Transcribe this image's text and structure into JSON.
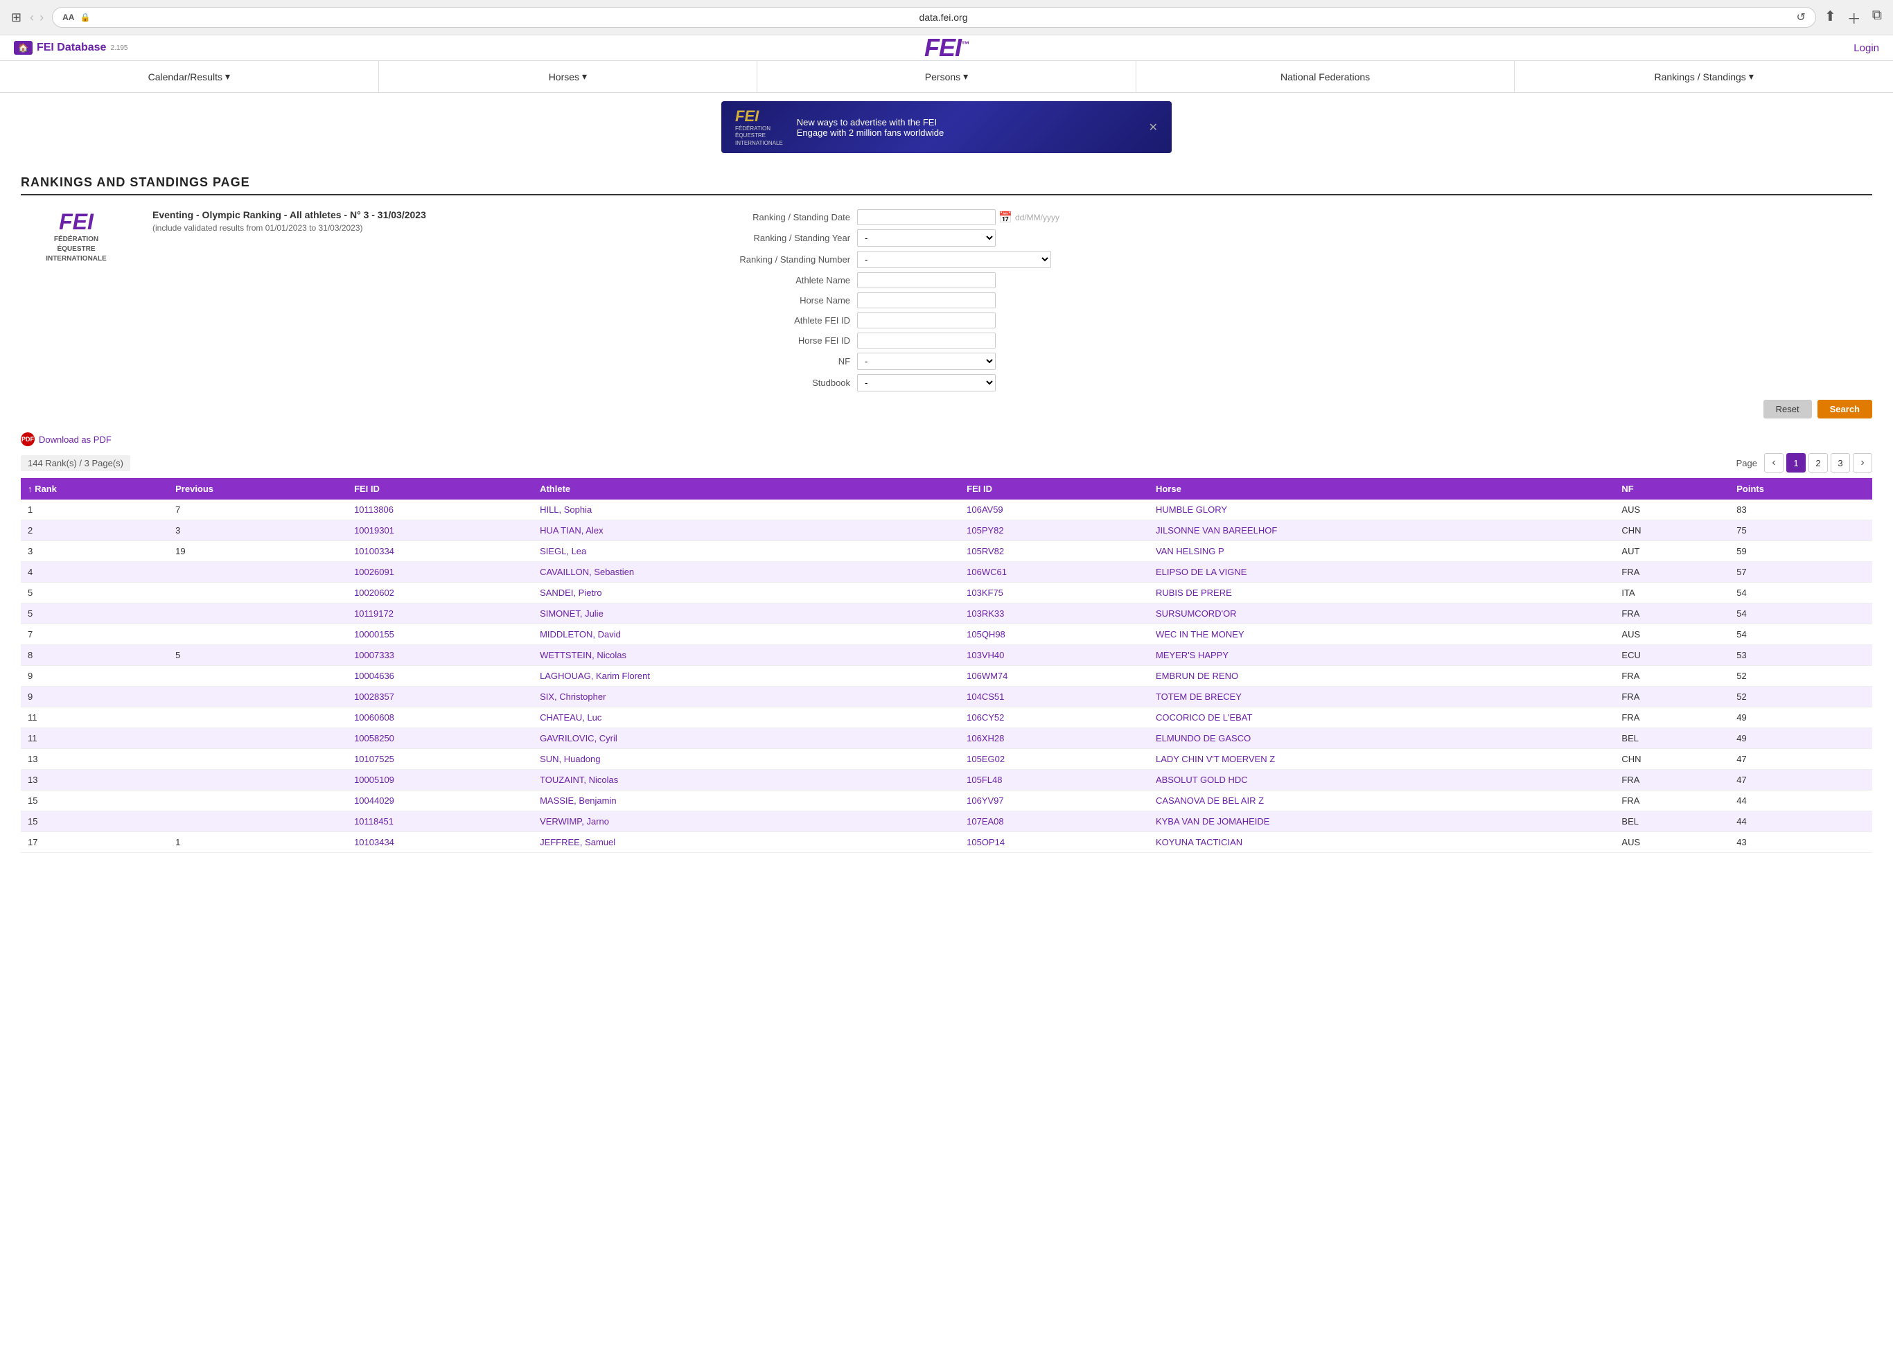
{
  "browser": {
    "aa_label": "AA",
    "url": "data.fei.org",
    "lock_icon": "🔒",
    "reload_icon": "↺"
  },
  "site": {
    "db_label": "FEI Database",
    "version": "2.195",
    "logo_text": "FEI",
    "logo_tm": "™",
    "login_label": "Login"
  },
  "nav": {
    "items": [
      {
        "label": "Calendar/Results",
        "has_dropdown": true
      },
      {
        "label": "Horses",
        "has_dropdown": true
      },
      {
        "label": "Persons",
        "has_dropdown": true
      },
      {
        "label": "National Federations",
        "has_dropdown": false
      },
      {
        "label": "Rankings / Standings",
        "has_dropdown": true
      }
    ]
  },
  "banner": {
    "logo": "FEI",
    "org_name": "FÉDÉRATION\nÉQUESTRE\nINTERNATIONALE",
    "headline": "New ways to advertise with the FEI",
    "subline": "Engage with 2 million fans worldwide"
  },
  "page_title": "RANKINGS AND STANDINGS PAGE",
  "ranking_info": {
    "title": "Eventing - Olympic Ranking - All athletes - N° 3 - 31/03/2023",
    "subtitle": "(include validated results from 01/01/2023 to 31/03/2023)"
  },
  "filter": {
    "ranking_date_label": "Ranking / Standing Date",
    "ranking_date_placeholder": "dd/MM/yyyy",
    "ranking_year_label": "Ranking / Standing Year",
    "ranking_number_label": "Ranking / Standing Number",
    "athlete_name_label": "Athlete Name",
    "horse_name_label": "Horse Name",
    "athlete_fei_id_label": "Athlete FEI ID",
    "horse_fei_id_label": "Horse FEI ID",
    "nf_label": "NF",
    "studbook_label": "Studbook",
    "reset_label": "Reset",
    "search_label": "Search"
  },
  "logo": {
    "text": "FEI",
    "org_line1": "FÉDÉRATION",
    "org_line2": "ÉQUESTRE",
    "org_line3": "INTERNATIONALE"
  },
  "download": {
    "label": "Download as PDF"
  },
  "pagination": {
    "record_count": "144 Rank(s) / 3 Page(s)",
    "page_label": "Page",
    "current_page": 1,
    "pages": [
      1,
      2,
      3
    ]
  },
  "table": {
    "columns": [
      "Rank",
      "Previous",
      "FEI ID",
      "Athlete",
      "FEI ID",
      "Horse",
      "NF",
      "Points"
    ],
    "rows": [
      {
        "rank": "1",
        "previous": "7",
        "fei_id_athlete": "10113806",
        "athlete": "HILL, Sophia",
        "fei_id_horse": "106AV59",
        "horse": "HUMBLE GLORY",
        "nf": "AUS",
        "points": "83"
      },
      {
        "rank": "2",
        "previous": "3",
        "fei_id_athlete": "10019301",
        "athlete": "HUA TIAN, Alex",
        "fei_id_horse": "105PY82",
        "horse": "JILSONNE VAN BAREELHOF",
        "nf": "CHN",
        "points": "75"
      },
      {
        "rank": "3",
        "previous": "19",
        "fei_id_athlete": "10100334",
        "athlete": "SIEGL, Lea",
        "fei_id_horse": "105RV82",
        "horse": "VAN HELSING P",
        "nf": "AUT",
        "points": "59"
      },
      {
        "rank": "4",
        "previous": "",
        "fei_id_athlete": "10026091",
        "athlete": "CAVAILLON, Sebastien",
        "fei_id_horse": "106WC61",
        "horse": "ELIPSO DE LA VIGNE",
        "nf": "FRA",
        "points": "57"
      },
      {
        "rank": "5",
        "previous": "",
        "fei_id_athlete": "10020602",
        "athlete": "SANDEI, Pietro",
        "fei_id_horse": "103KF75",
        "horse": "RUBIS DE PRERE",
        "nf": "ITA",
        "points": "54"
      },
      {
        "rank": "5",
        "previous": "",
        "fei_id_athlete": "10119172",
        "athlete": "SIMONET, Julie",
        "fei_id_horse": "103RK33",
        "horse": "SURSUMCORD'OR",
        "nf": "FRA",
        "points": "54"
      },
      {
        "rank": "7",
        "previous": "",
        "fei_id_athlete": "10000155",
        "athlete": "MIDDLETON, David",
        "fei_id_horse": "105QH98",
        "horse": "WEC IN THE MONEY",
        "nf": "AUS",
        "points": "54"
      },
      {
        "rank": "8",
        "previous": "5",
        "fei_id_athlete": "10007333",
        "athlete": "WETTSTEIN, Nicolas",
        "fei_id_horse": "103VH40",
        "horse": "MEYER'S HAPPY",
        "nf": "ECU",
        "points": "53"
      },
      {
        "rank": "9",
        "previous": "",
        "fei_id_athlete": "10004636",
        "athlete": "LAGHOUAG, Karim Florent",
        "fei_id_horse": "106WM74",
        "horse": "EMBRUN DE RENO",
        "nf": "FRA",
        "points": "52"
      },
      {
        "rank": "9",
        "previous": "",
        "fei_id_athlete": "10028357",
        "athlete": "SIX, Christopher",
        "fei_id_horse": "104CS51",
        "horse": "TOTEM DE BRECEY",
        "nf": "FRA",
        "points": "52"
      },
      {
        "rank": "11",
        "previous": "",
        "fei_id_athlete": "10060608",
        "athlete": "CHATEAU, Luc",
        "fei_id_horse": "106CY52",
        "horse": "COCORICO DE L'EBAT",
        "nf": "FRA",
        "points": "49"
      },
      {
        "rank": "11",
        "previous": "",
        "fei_id_athlete": "10058250",
        "athlete": "GAVRILOVIC, Cyril",
        "fei_id_horse": "106XH28",
        "horse": "ELMUNDO DE GASCO",
        "nf": "BEL",
        "points": "49"
      },
      {
        "rank": "13",
        "previous": "",
        "fei_id_athlete": "10107525",
        "athlete": "SUN, Huadong",
        "fei_id_horse": "105EG02",
        "horse": "LADY CHIN V'T MOERVEN Z",
        "nf": "CHN",
        "points": "47"
      },
      {
        "rank": "13",
        "previous": "",
        "fei_id_athlete": "10005109",
        "athlete": "TOUZAINT, Nicolas",
        "fei_id_horse": "105FL48",
        "horse": "ABSOLUT GOLD HDC",
        "nf": "FRA",
        "points": "47"
      },
      {
        "rank": "15",
        "previous": "",
        "fei_id_athlete": "10044029",
        "athlete": "MASSIE, Benjamin",
        "fei_id_horse": "106YV97",
        "horse": "CASANOVA DE BEL AIR Z",
        "nf": "FRA",
        "points": "44"
      },
      {
        "rank": "15",
        "previous": "",
        "fei_id_athlete": "10118451",
        "athlete": "VERWIMP, Jarno",
        "fei_id_horse": "107EA08",
        "horse": "KYBA VAN DE JOMAHEIDE",
        "nf": "BEL",
        "points": "44"
      },
      {
        "rank": "17",
        "previous": "1",
        "fei_id_athlete": "10103434",
        "athlete": "JEFFREE, Samuel",
        "fei_id_horse": "105OP14",
        "horse": "KOYUNA TACTICIAN",
        "nf": "AUS",
        "points": "43"
      }
    ]
  }
}
